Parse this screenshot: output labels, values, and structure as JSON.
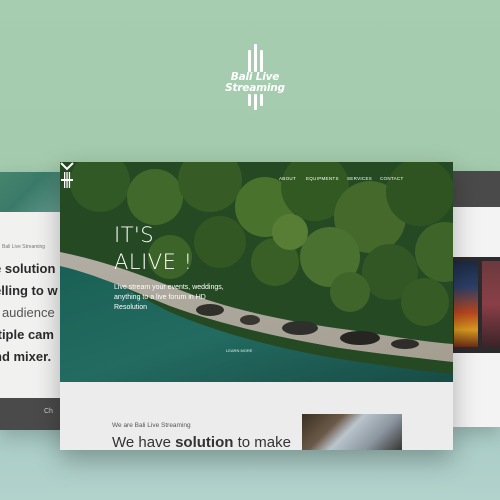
{
  "brand": {
    "line1": "Bali Live",
    "line2": "Streaming",
    "color": "#ffffff"
  },
  "main_site": {
    "nav": {
      "logo": "bali-live-streaming-logo",
      "items": [
        "ABOUT",
        "EQUIPMENTS",
        "SERVICES",
        "CONTACT"
      ]
    },
    "hero": {
      "title_line1": "IT'S",
      "title_line2": "ALIVE !",
      "subtitle": "Live stream your events, weddings, anything to a live forum in HD Resolution",
      "scroll_label": "LEARN MORE",
      "scroll_icon": "chevron-down-icon"
    },
    "intro": {
      "small": "We are Bali Live Streaming",
      "big_prefix": "We have ",
      "big_bold": "solution",
      "big_suffix": " to make"
    }
  },
  "left_site": {
    "small_text": "Bali Live Streaming",
    "lines": [
      "e solution",
      "elling to w",
      "r audience",
      "ltiple cam",
      "nd mixer."
    ],
    "dark_text": "Ch"
  },
  "colors": {
    "background": "#a4cbae",
    "floor": "#aed0ca"
  }
}
